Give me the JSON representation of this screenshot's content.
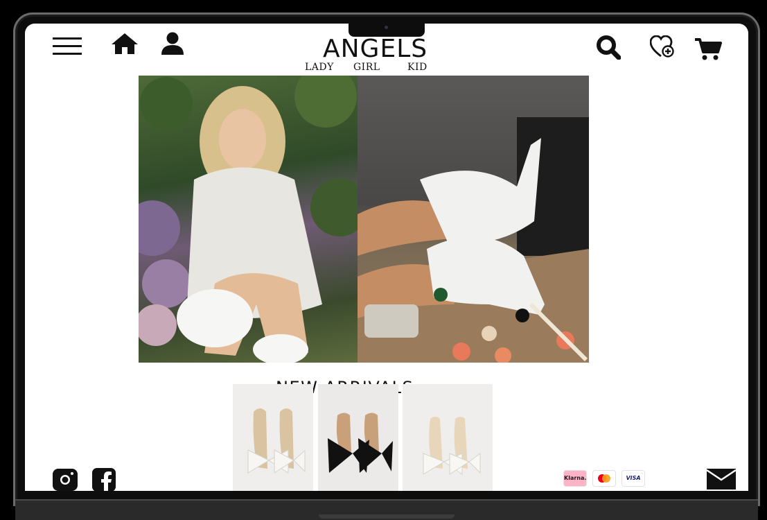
{
  "brand": {
    "title": "ANGELS",
    "sub_left": "LADY",
    "sub_mid": "GIRL",
    "sub_right": "KID"
  },
  "header": {
    "icons": [
      "menu-icon",
      "home-icon",
      "user-icon",
      "search-icon",
      "wishlist-icon",
      "cart-icon"
    ]
  },
  "sections": {
    "new_arrivals": "NEW ARRIVALS"
  },
  "products": [
    {
      "name": "white-bow-mule",
      "color": "#f5f3ee"
    },
    {
      "name": "black-bow-mule",
      "color": "#111111"
    },
    {
      "name": "white-bow-pump",
      "color": "#f4f2ec"
    }
  ],
  "payments": [
    "Klarna.",
    "Mastercard",
    "VISA"
  ],
  "footer": {
    "icons": [
      "instagram-icon",
      "facebook-icon",
      "mail-icon"
    ]
  },
  "colors": {
    "ink": "#111111",
    "klarna_pink": "#ffb3c7",
    "visa_blue": "#1a1f71"
  }
}
